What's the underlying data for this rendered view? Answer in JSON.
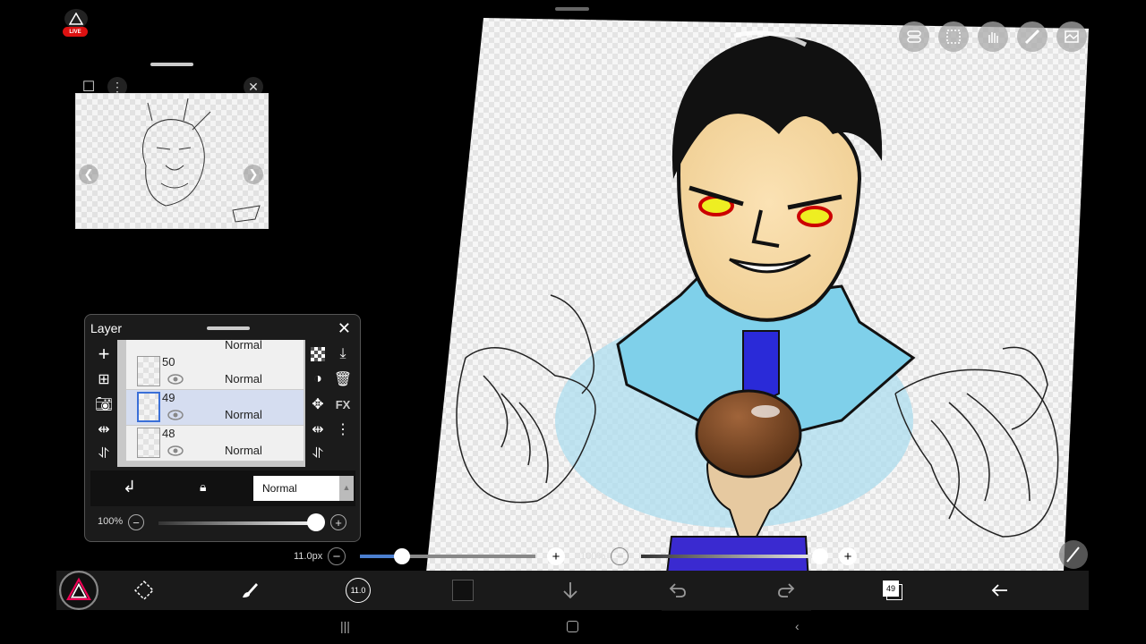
{
  "app": {
    "name": "ibis Paint",
    "live_badge": "LIVE"
  },
  "layer_panel": {
    "title": "Layer",
    "top_row_mode": "Normal",
    "layers": [
      {
        "number": "50",
        "mode": "Normal",
        "selected": false
      },
      {
        "number": "49",
        "mode": "Normal",
        "selected": true
      },
      {
        "number": "48",
        "mode": "Normal",
        "selected": false
      }
    ],
    "blend_mode": "Normal",
    "opacity": "100%",
    "side_left_icons": [
      "add-layer-icon",
      "duplicate-layer-icon",
      "camera-icon",
      "flip-horizontal-icon",
      "merge-down-icon"
    ],
    "side_right_icons": [
      "transparency-icon",
      "import-icon",
      "mask-icon",
      "delete-icon",
      "move-icon",
      "fx-icon",
      "flip-icon",
      "more-icon"
    ],
    "fx_label": "FX"
  },
  "brush_size": {
    "label": "11.0px",
    "fraction": 0.24
  },
  "brush_opacity": {
    "label": "100%",
    "fraction": 1.0
  },
  "toolbar": {
    "brush_size_value": "11.0",
    "layer_number": "49",
    "items": [
      "ibis-logo-icon",
      "transform-icon",
      "brush-icon",
      "brush-size-icon",
      "color-swatch",
      "down-arrow-icon",
      "undo-icon",
      "redo-icon",
      "layer-count-icon",
      "back-icon"
    ]
  },
  "top_tools": [
    "toggle-icon",
    "selection-icon",
    "hand-icon",
    "ruler-icon",
    "material-icon"
  ],
  "colors": {
    "accent": "#4b7fd0",
    "selection": "#d5ddf0",
    "live": "#dd1111"
  }
}
